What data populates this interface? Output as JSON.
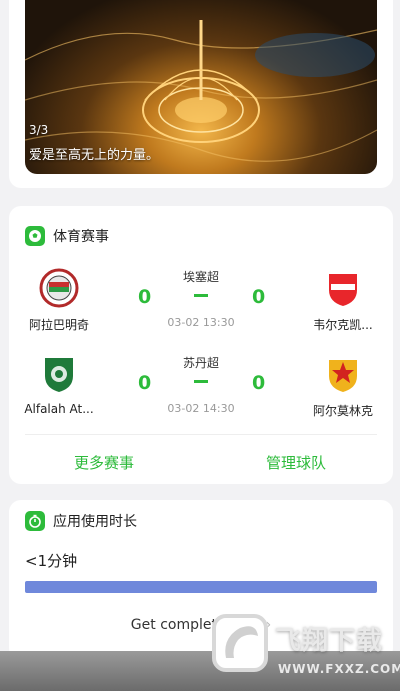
{
  "banner": {
    "counter": "3/3",
    "caption": "爱是至高无上的力量。"
  },
  "sports": {
    "title": "体育赛事",
    "matches": [
      {
        "league": "埃塞超",
        "home": {
          "name": "阿拉巴明奇",
          "score": "0"
        },
        "away": {
          "name": "韦尔克凯...",
          "score": "0"
        },
        "time": "03-02 13:30"
      },
      {
        "league": "苏丹超",
        "home": {
          "name": "Alfalah At...",
          "score": "0"
        },
        "away": {
          "name": "阿尔莫林克",
          "score": "0"
        },
        "time": "03-02 14:30"
      }
    ],
    "more_label": "更多赛事",
    "manage_label": "管理球队"
  },
  "usage": {
    "title": "应用使用时长",
    "value": "<1分钟",
    "progress": 1.0,
    "get_data_label": "Get complete data"
  },
  "watermark": {
    "text": "飞翔下载",
    "url": "WWW.FXXZ.COM"
  },
  "colors": {
    "accent": "#2dbb3b",
    "progress": "#6f88db"
  }
}
